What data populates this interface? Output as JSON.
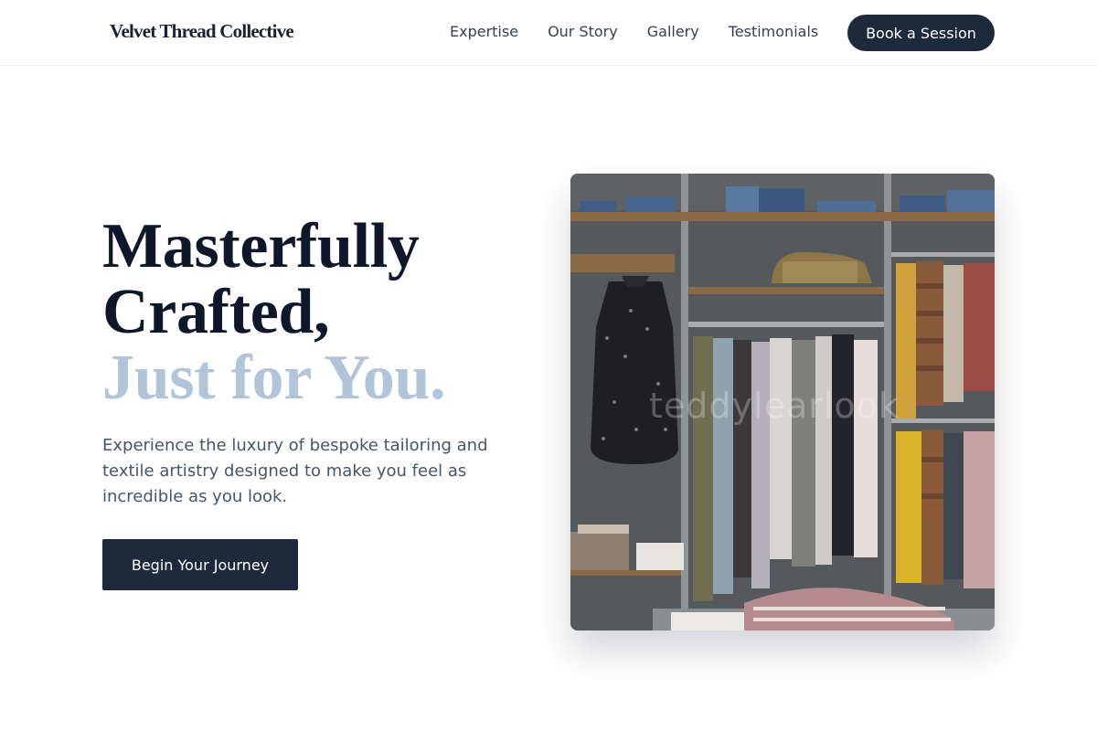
{
  "nav": {
    "brand": "Velvet Thread Collective",
    "links": [
      "Expertise",
      "Our Story",
      "Gallery",
      "Testimonials"
    ],
    "cta": "Book a Session"
  },
  "hero": {
    "headline_line1": "Masterfully",
    "headline_line2": "Crafted,",
    "headline_accent": "Just for You.",
    "description": "Experience the luxury of bespoke tailoring and textile artistry designed to make you feel as incredible as you look.",
    "cta": "Begin Your Journey",
    "image": {
      "description": "clothing boutique rack with dresses, shirts and folded jeans",
      "watermark": "teddylearlook"
    }
  },
  "colors": {
    "primary": "#1e293b",
    "heading": "#0f172a",
    "accent": "#b1c4da",
    "body_text": "#475569"
  }
}
